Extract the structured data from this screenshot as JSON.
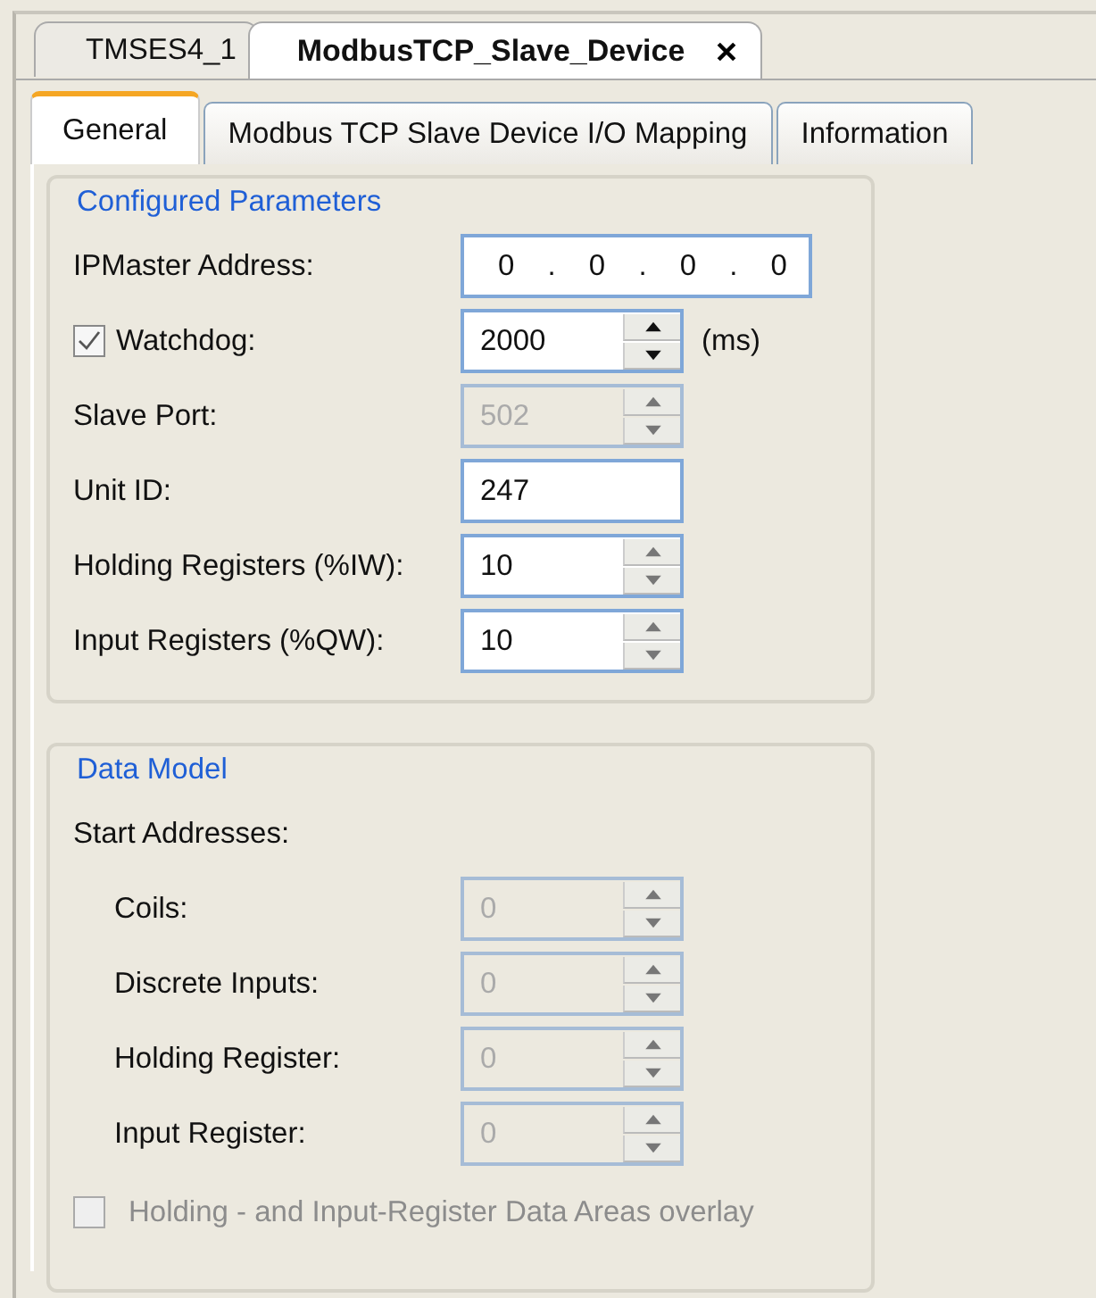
{
  "editor_tabs": [
    {
      "label": "TMSES4_1",
      "selected": false,
      "closable": false
    },
    {
      "label": "ModbusTCP_Slave_Device",
      "selected": true,
      "closable": true
    }
  ],
  "tabs": [
    {
      "label": "General",
      "selected": true
    },
    {
      "label": "Modbus TCP Slave Device I/O Mapping",
      "selected": false
    },
    {
      "label": "Information",
      "selected": false
    }
  ],
  "groups": [
    {
      "title": "Configured Parameters",
      "rows": [
        {
          "kind": "ip",
          "label": "IPMaster Address:",
          "value": "0 . 0 . 0 . 0"
        },
        {
          "kind": "spin",
          "label": "Watchdog:",
          "checkbox": true,
          "checked": true,
          "value": "2000",
          "unit": "(ms)",
          "disabled": false,
          "arrows_enabled": true
        },
        {
          "kind": "spin",
          "label": "Slave Port:",
          "value": "502",
          "disabled": true,
          "arrows_enabled": false
        },
        {
          "kind": "text",
          "label": "Unit ID:",
          "value": "247",
          "disabled": false
        },
        {
          "kind": "spin",
          "label": "Holding Registers (%IW):",
          "value": "10",
          "disabled": false,
          "arrows_enabled": false
        },
        {
          "kind": "spin",
          "label": "Input Registers (%QW):",
          "value": "10",
          "disabled": false,
          "arrows_enabled": false
        }
      ]
    },
    {
      "title": "Data Model",
      "rows": [
        {
          "kind": "heading",
          "label": "Start Addresses:",
          "children": [
            {
              "kind": "spin",
              "label": "Coils:",
              "value": "0",
              "disabled": true,
              "arrows_enabled": false
            },
            {
              "kind": "spin",
              "label": "Discrete Inputs:",
              "value": "0",
              "disabled": true,
              "arrows_enabled": false
            },
            {
              "kind": "spin",
              "label": "Holding Register:",
              "value": "0",
              "disabled": true,
              "arrows_enabled": false
            },
            {
              "kind": "spin",
              "label": "Input Register:",
              "value": "0",
              "disabled": true,
              "arrows_enabled": false
            }
          ]
        },
        {
          "kind": "checkbox",
          "label": "Holding - and Input-Register Data Areas overlay",
          "checked": false,
          "disabled": true
        }
      ]
    }
  ]
}
